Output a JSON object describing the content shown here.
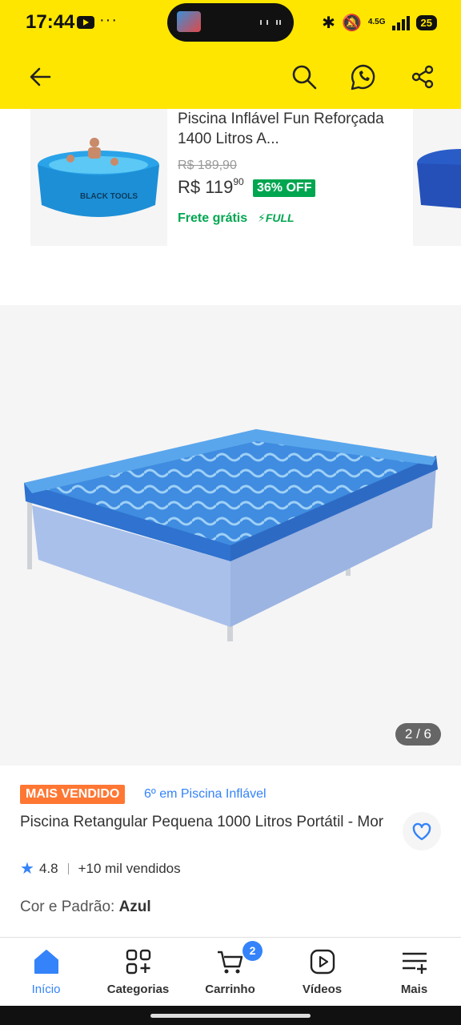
{
  "status_bar": {
    "time": "17:44",
    "dots": "···",
    "network": "4.5G",
    "battery": "25"
  },
  "related_product": {
    "title": "Piscina Inflável Fun Reforçada 1400 Litros A...",
    "old_price": "R$ 189,90",
    "price": "R$ 119",
    "price_cents": "90",
    "discount": "36% OFF",
    "shipping": "Frete grátis",
    "full_label": "FULL",
    "image_text": "BLACK TOOLS"
  },
  "gallery": {
    "counter": "2 / 6"
  },
  "product": {
    "badge": "MAIS VENDIDO",
    "ranking": "6º em Piscina Inflável",
    "title": "Piscina Retangular Pequena 1000 Litros Portátil - Mor",
    "rating": "4.8",
    "sold": "+10 mil vendidos",
    "color_label": "Cor e Padrão: ",
    "color_value": "Azul"
  },
  "tabs": [
    {
      "label": "Início",
      "icon": "home-icon"
    },
    {
      "label": "Categorias",
      "icon": "categories-icon"
    },
    {
      "label": "Carrinho",
      "icon": "cart-icon",
      "badge": "2"
    },
    {
      "label": "Vídeos",
      "icon": "video-icon"
    },
    {
      "label": "Mais",
      "icon": "more-icon"
    }
  ],
  "colors": {
    "brand_yellow": "#FFE600",
    "accent_blue": "#3483FA",
    "discount_green": "#00A650",
    "badge_orange": "#FF7733"
  }
}
